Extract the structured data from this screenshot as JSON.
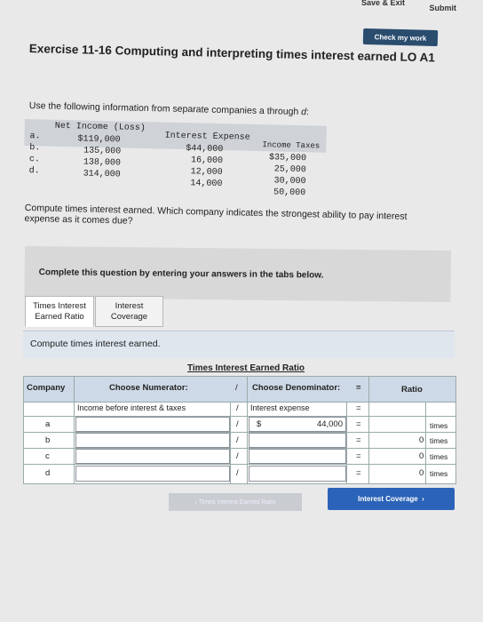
{
  "header": {
    "save_exit": "Save & Exit",
    "submit": "Submit"
  },
  "check_button": "Check my work",
  "exercise_title": "Exercise 11-16 Computing and interpreting times interest earned LO A1",
  "intro_text": "Use the following information from separate companies a through",
  "intro_letter": "d",
  "data_table": {
    "headers": [
      "Net Income (Loss)",
      "Interest Expense",
      "Income Taxes"
    ],
    "rows": [
      {
        "label": "a.",
        "net_income": "$119,000",
        "interest": "$44,000",
        "taxes": "$35,000"
      },
      {
        "label": "b.",
        "net_income": "135,000",
        "interest": "16,000",
        "taxes": "25,000"
      },
      {
        "label": "c.",
        "net_income": "138,000",
        "interest": "12,000",
        "taxes": "30,000"
      },
      {
        "label": "d.",
        "net_income": "314,000",
        "interest": "14,000",
        "taxes": "50,000"
      }
    ]
  },
  "question_text": "Compute times interest earned. Which company indicates the strongest ability to pay interest expense as it comes due?",
  "complete_text": "Complete this question by entering your answers in the tabs below.",
  "tabs": [
    {
      "label": "Times Interest Earned Ratio"
    },
    {
      "label": "Interest Coverage"
    }
  ],
  "panel_text": "Compute times interest earned.",
  "answer_table": {
    "title": "Times Interest Earned Ratio",
    "company_header": "Company",
    "numerator_header": "Choose Numerator:",
    "slash": "/",
    "denominator_header": "Choose Denominator:",
    "equals": "=",
    "ratio_header": "Ratio",
    "subhead_numerator": "Income before interest & taxes",
    "subhead_denominator": "Interest expense",
    "rows": [
      {
        "company": "a",
        "den_prefix": "$",
        "den_value": "44,000",
        "ratio": "",
        "unit": "times"
      },
      {
        "company": "b",
        "den_prefix": "",
        "den_value": "",
        "ratio": "0",
        "unit": "times"
      },
      {
        "company": "c",
        "den_prefix": "",
        "den_value": "",
        "ratio": "0",
        "unit": "times"
      },
      {
        "company": "d",
        "den_prefix": "",
        "den_value": "",
        "ratio": "0",
        "unit": "times"
      }
    ]
  },
  "nav": {
    "prev": "Times Interest Earned Ratio",
    "next": "Interest Coverage"
  },
  "colors": {
    "check_button": "#2a4d6e",
    "next_button": "#2b63b8",
    "table_header": "#cdd9e6"
  }
}
